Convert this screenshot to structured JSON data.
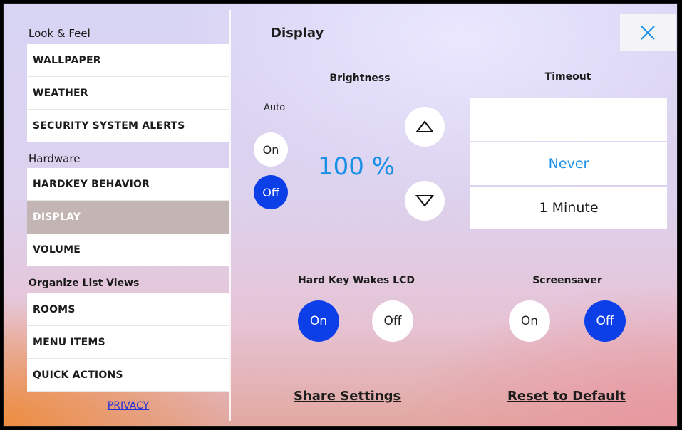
{
  "sidebar": {
    "sections": [
      {
        "title": "Look & Feel"
      },
      {
        "title": "Hardware"
      },
      {
        "title": "Organize List Views"
      }
    ],
    "items": [
      {
        "label": "WALLPAPER"
      },
      {
        "label": "WEATHER"
      },
      {
        "label": "SECURITY SYSTEM ALERTS"
      },
      {
        "label": "HARDKEY BEHAVIOR"
      },
      {
        "label": "DISPLAY"
      },
      {
        "label": "VOLUME"
      },
      {
        "label": "ROOMS"
      },
      {
        "label": "MENU ITEMS"
      },
      {
        "label": "QUICK ACTIONS"
      }
    ],
    "active_item": "DISPLAY",
    "privacy_label": "PRIVACY"
  },
  "main": {
    "title": "Display",
    "close_icon": "close-x-icon",
    "brightness": {
      "label": "Brightness",
      "auto_label": "Auto",
      "auto_on_label": "On",
      "auto_off_label": "Off",
      "auto_selected": "Off",
      "value": "100 %",
      "up_icon": "triangle-up-icon",
      "down_icon": "triangle-down-icon"
    },
    "timeout": {
      "label": "Timeout",
      "options": [
        "",
        "Never",
        "1 Minute"
      ],
      "selected": "Never"
    },
    "hard_key": {
      "label": "Hard Key Wakes LCD",
      "on_label": "On",
      "off_label": "Off",
      "selected": "On"
    },
    "screensaver": {
      "label": "Screensaver",
      "on_label": "On",
      "off_label": "Off",
      "selected": "Off"
    },
    "share_label": "Share Settings",
    "reset_label": "Reset to Default"
  },
  "colors": {
    "accent_blue": "#0d3fe8",
    "value_blue": "#1a8fe6",
    "active_item_bg": "#c2b5b3",
    "link_blue": "#2230d8"
  }
}
